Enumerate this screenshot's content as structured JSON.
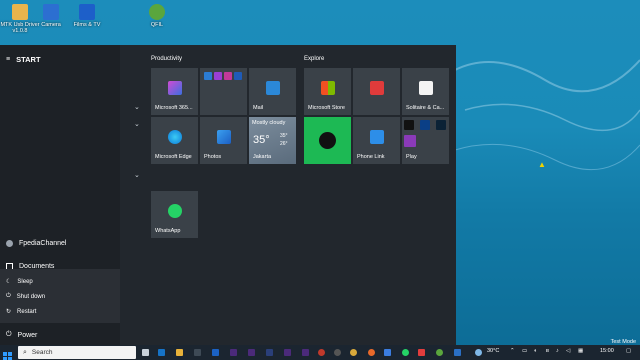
{
  "desktop": {
    "icons": [
      {
        "label": "MTK Usb Driver v1.0.8",
        "name": "folder-icon",
        "color": "#e9b44c"
      },
      {
        "label": "Camera",
        "name": "camera-icon",
        "color": "#2c6fd1"
      },
      {
        "label": "Films & TV",
        "name": "films-tv-icon",
        "color": "#1d5fc9"
      },
      {
        "label": "QFIL",
        "name": "qfil-icon",
        "color": "#5aa63d"
      }
    ],
    "test_mode": "Test Mode"
  },
  "start_menu": {
    "title": "START",
    "user": "FpediaChannel",
    "documents": "Documents",
    "power": "Power",
    "power_options": [
      "Sleep",
      "Shut down",
      "Restart"
    ],
    "groups": {
      "productivity": "Productivity",
      "explore": "Explore"
    },
    "tiles": {
      "microsoft365": "Microsoft 365...",
      "mail": "Mail",
      "edge": "Microsoft Edge",
      "photos": "Photos",
      "store": "Microsoft Store",
      "solitaire": "Solitaire & Ca...",
      "phone_link": "Phone Link",
      "play": "Play",
      "whatsapp": "WhatsApp"
    },
    "weather": {
      "condition": "Mostly cloudy",
      "temp": "35°",
      "hi": "35°",
      "lo": "26°",
      "city": "Jakarta"
    }
  },
  "taskbar": {
    "search_placeholder": "Search",
    "temperature": "30°C",
    "time": "15:00"
  },
  "colors": {
    "tile": "#3a4148",
    "spotify": "#1db954",
    "accent_blue": "#1f7ad8"
  }
}
